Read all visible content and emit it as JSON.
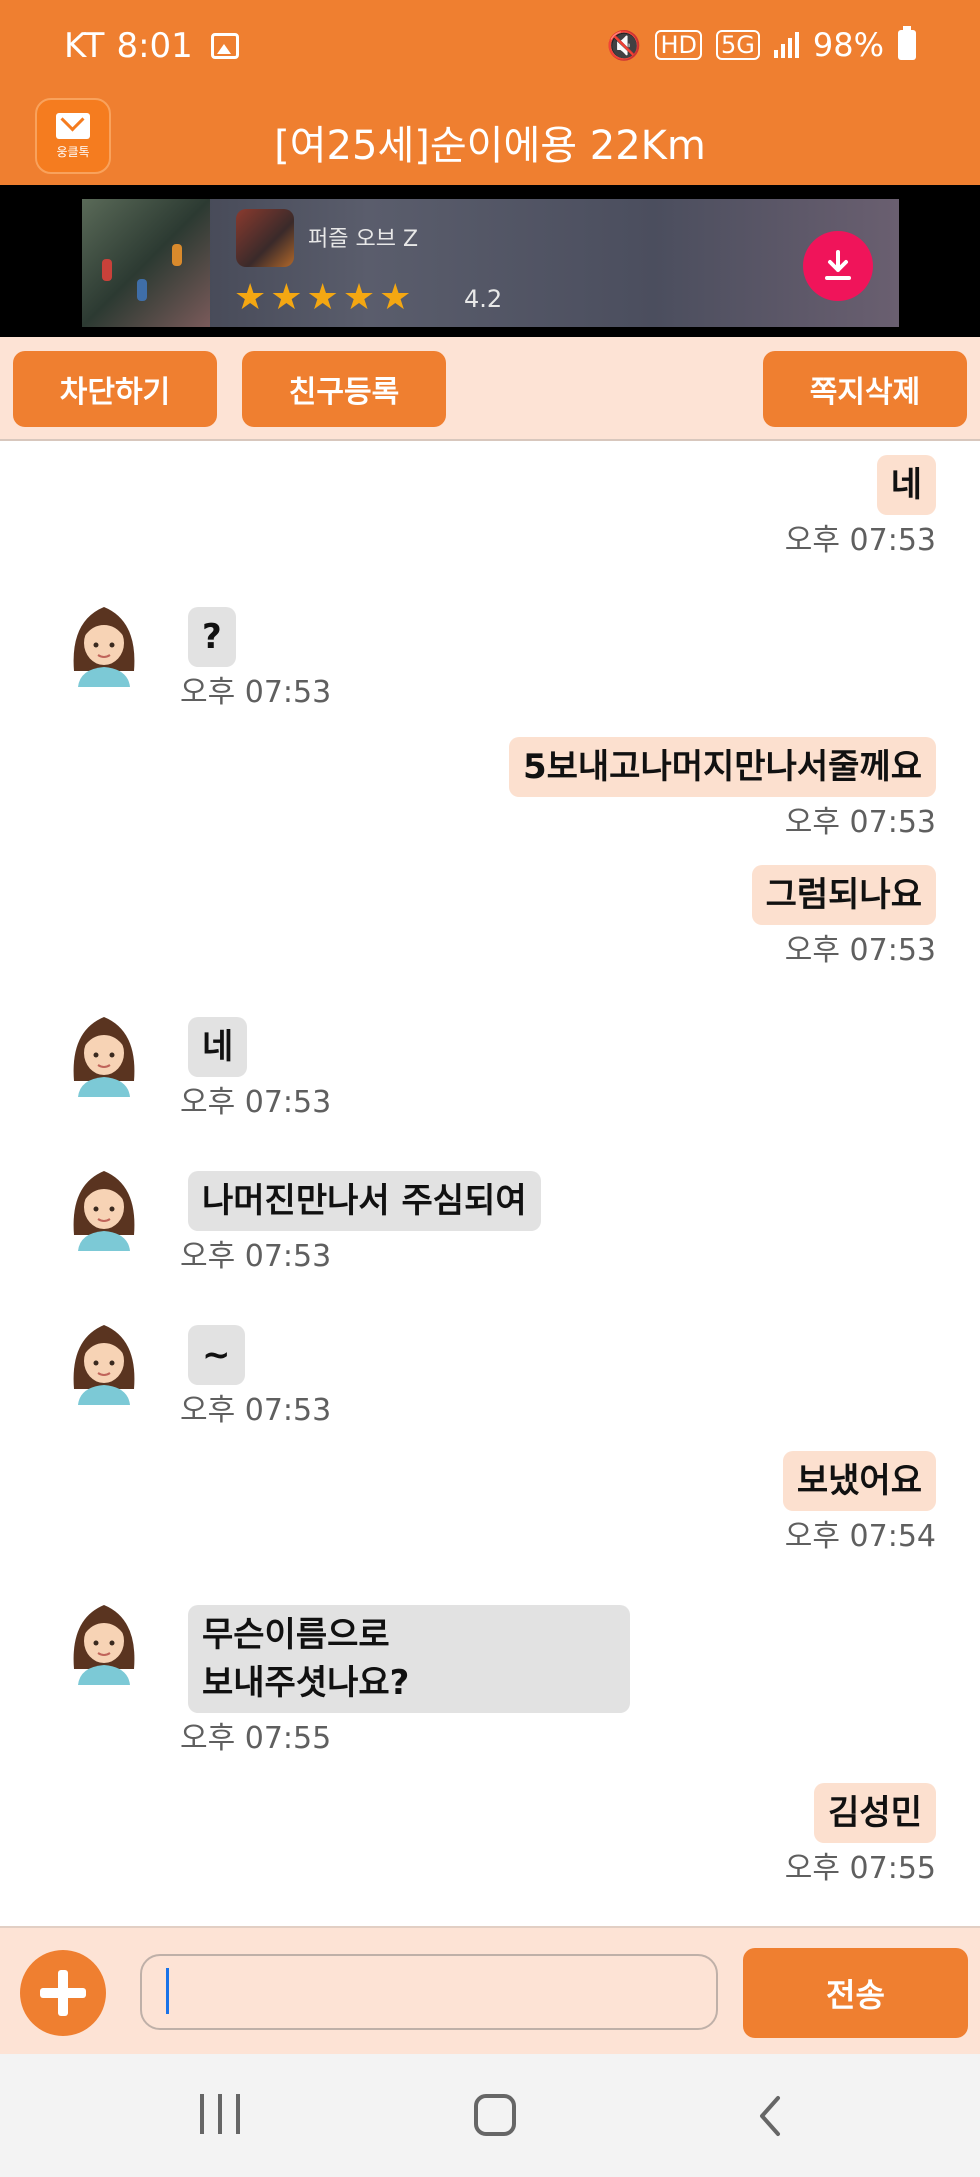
{
  "status_bar": {
    "carrier": "KT",
    "time": "8:01",
    "network": "5G",
    "hd": "HD",
    "battery": "98%"
  },
  "header": {
    "title": "[여25세]순이에용 22Km",
    "logo_text": "웅클톡"
  },
  "ad": {
    "app_name": "퍼즐 오브 Z",
    "rating": "4.2",
    "stars": "★★★★★"
  },
  "actions": {
    "block": "차단하기",
    "friend": "친구등록",
    "delete": "쪽지삭제"
  },
  "messages": [
    {
      "dir": "out",
      "text": "네",
      "time": "오후 07:53"
    },
    {
      "dir": "in",
      "text": "?",
      "time": "오후 07:53"
    },
    {
      "dir": "out",
      "text": "5보내고나머지만나서줄께요",
      "time": "오후 07:53"
    },
    {
      "dir": "out",
      "text": "그럼되나요",
      "time": "오후 07:53"
    },
    {
      "dir": "in",
      "text": "네",
      "time": "오후 07:53"
    },
    {
      "dir": "in",
      "text": "나머진만나서 주심되여",
      "time": "오후 07:53"
    },
    {
      "dir": "in",
      "text": "~",
      "time": "오후 07:53"
    },
    {
      "dir": "out",
      "text": "보냈어요",
      "time": "오후 07:54"
    },
    {
      "dir": "in",
      "text": "무슨이름으로\n보내주셧나요?",
      "time": "오후 07:55"
    },
    {
      "dir": "out",
      "text": "김성민",
      "time": "오후 07:55"
    }
  ],
  "composer": {
    "value": "",
    "send": "전송"
  },
  "colors": {
    "accent": "#EF7F30",
    "bubble_out": "#FCE0CF",
    "bubble_in": "#E2E2E2",
    "bar_bg": "#FDE3D5"
  }
}
